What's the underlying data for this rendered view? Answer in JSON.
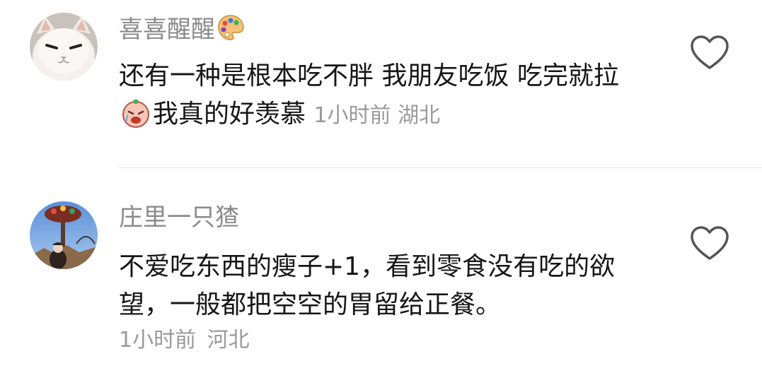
{
  "comments": [
    {
      "username": "喜喜醒醒",
      "avatar_icon": "white-cat-avatar",
      "username_emoji": "artist-palette-icon",
      "text_part1": "还有一种是根本吃不胖 我朋友吃饭 吃完就拉",
      "inline_emoji": "crying-face-sticker-icon",
      "text_part2": "我真的好羡慕",
      "time": "1小时前",
      "location": "湖北",
      "like_icon": "heart-outline-icon"
    },
    {
      "username": "庄里一只猹",
      "avatar_icon": "carnival-photo-avatar",
      "text": "不爱吃东西的瘦子+1，看到零食没有吃的欲望，一般都把空空的胃留给正餐。",
      "time": "1小时前",
      "location": "河北",
      "like_icon": "heart-outline-icon"
    }
  ],
  "colors": {
    "text": "#161616",
    "meta": "#9a9a9a",
    "username": "#8a8a8a",
    "divider": "#e6e6e6"
  }
}
